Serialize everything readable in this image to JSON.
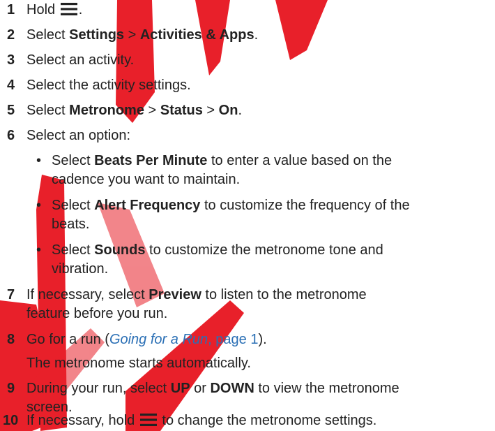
{
  "icons": {
    "menu": "menu-icon"
  },
  "colors": {
    "text": "#222222",
    "link": "#2a6fb5",
    "watermark": "#e8202a"
  },
  "steps": {
    "s1": {
      "num": "1",
      "pre": "Hold",
      "post": "."
    },
    "s2": {
      "num": "2",
      "a": "Select ",
      "b1": "Settings",
      "c": " > ",
      "b2": "Activities & Apps",
      "d": "."
    },
    "s3": {
      "num": "3",
      "text": "Select an activity."
    },
    "s4": {
      "num": "4",
      "text": "Select the activity settings."
    },
    "s5": {
      "num": "5",
      "a": "Select ",
      "b1": "Metronome",
      "c1": " > ",
      "b2": "Status",
      "c2": " > ",
      "b3": "On",
      "d": "."
    },
    "s6": {
      "num": "6",
      "text": "Select an option:"
    },
    "opt1": {
      "bullet": "•",
      "a": "Select ",
      "b": "Beats Per Minute",
      "c": " to enter a value based on the",
      "line2": "cadence you want to maintain."
    },
    "opt2": {
      "bullet": "•",
      "a": "Select ",
      "b": "Alert Frequency",
      "c": " to customize the frequency of the",
      "line2": "beats."
    },
    "opt3": {
      "bullet": "•",
      "a": "Select ",
      "b": "Sounds",
      "c": " to customize the metronome tone and",
      "line2": "vibration."
    },
    "s7": {
      "num": "7",
      "a": "If necessary, select ",
      "b": "Preview",
      "c": " to listen to the metronome",
      "line2": "feature before you run."
    },
    "s8": {
      "num": "8",
      "a": "Go for a run (",
      "link_title": "Going for a Run",
      "comma": ", ",
      "link_page": "page 1",
      "b": ").",
      "line2": "The metronome starts automatically."
    },
    "s9": {
      "num": "9",
      "a": "During your run, select ",
      "b1": "UP",
      "c": " or ",
      "b2": "DOWN",
      "d": " to view the metronome",
      "line2": "screen."
    },
    "s10": {
      "num": "10",
      "a": "If necessary, hold ",
      "c": " to change the metronome settings."
    }
  }
}
